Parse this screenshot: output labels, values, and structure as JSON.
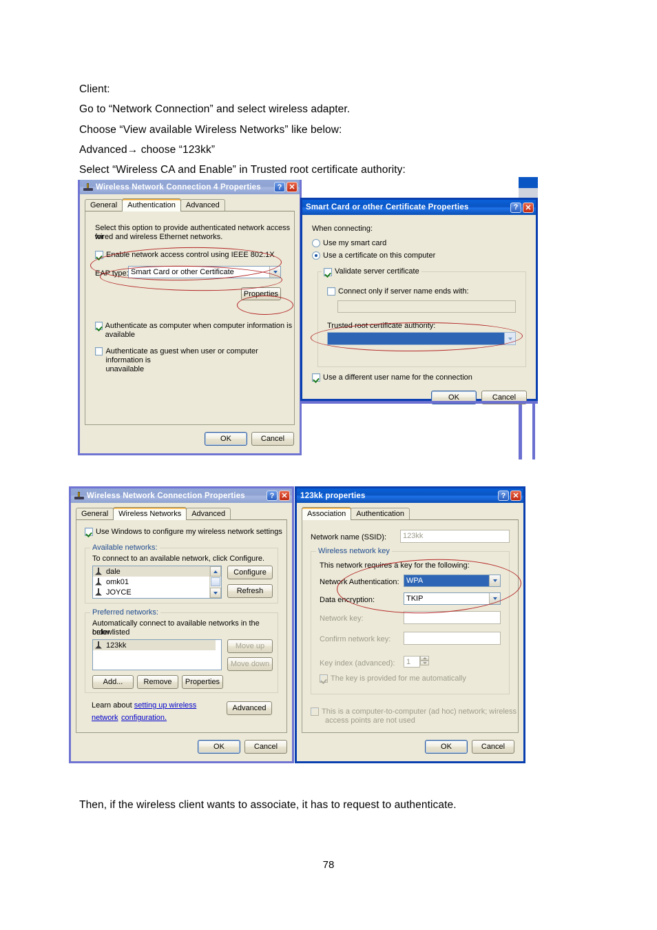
{
  "doc": {
    "lines": [
      "Client:",
      "Go to “Network Connection” and select wireless adapter.",
      "Choose “View available Wireless Networks” like below:",
      "Advanced→ choose “123kk”",
      "Select “Wireless CA and Enable” in Trusted root certificate authority:"
    ],
    "closing_line": "Then, if the wireless client wants to associate, it has to request to authenticate.",
    "page_number": "78"
  },
  "colors": {
    "title_active": "#0a55c4",
    "title_inactive": "#93a9d8",
    "dialog_face": "#ece9d8",
    "annotation_red": "#b22222",
    "selection_blue": "#2e66b5",
    "link_blue": "#0000cc"
  },
  "win_auth": {
    "title": "Wireless Network Connection 4 Properties",
    "help_btn": "?",
    "close_btn": "✕",
    "tabs": [
      {
        "label": "General",
        "selected": false
      },
      {
        "label": "Authentication",
        "selected": true
      },
      {
        "label": "Advanced",
        "selected": false
      }
    ],
    "intro_line1": "Select this option to provide authenticated network access for",
    "intro_line2": "wired and wireless Ethernet networks.",
    "enable_8021x": {
      "label": "Enable network access control using IEEE 802.1X",
      "checked": true
    },
    "eap_type_label": "EAP type:",
    "eap_type_value": "Smart Card or other Certificate",
    "properties_btn": "Properties",
    "auth_computer": {
      "label": "Authenticate as computer when computer information is available",
      "checked": true
    },
    "auth_guest_line1": "Authenticate as guest when user or computer information is",
    "auth_guest_line2": "unavailable",
    "auth_guest_checked": false,
    "ok_btn": "OK",
    "cancel_btn": "Cancel"
  },
  "win_smartcard": {
    "title": "Smart Card or other Certificate Properties",
    "help_btn": "?",
    "close_btn": "✕",
    "when_connecting": "When connecting:",
    "radio_smartcard": {
      "label": "Use my smart card",
      "selected": false
    },
    "radio_certificate": {
      "label": "Use a certificate on this computer",
      "selected": true
    },
    "validate_server": {
      "label": "Validate server certificate",
      "checked": true
    },
    "connect_only_if": {
      "label": "Connect only if server name ends with:",
      "checked": false
    },
    "server_name_value": "",
    "trusted_root_label": "Trusted root certificate authority:",
    "trusted_root_value": "",
    "different_user": {
      "label": "Use a different user name for the connection",
      "checked": true
    },
    "ok_btn": "OK",
    "cancel_btn": "Cancel"
  },
  "win_wnc": {
    "title": "Wireless Network Connection Properties",
    "help_btn": "?",
    "close_btn": "✕",
    "tabs": [
      {
        "label": "General",
        "selected": false
      },
      {
        "label": "Wireless Networks",
        "selected": true
      },
      {
        "label": "Advanced",
        "selected": false
      }
    ],
    "use_windows": {
      "label": "Use Windows to configure my wireless network settings",
      "checked": true
    },
    "available_group": "Available networks:",
    "available_hint": "To connect to an available network, click Configure.",
    "available_list": [
      "dale",
      "omk01",
      "JOYCE"
    ],
    "configure_btn": "Configure",
    "refresh_btn": "Refresh",
    "preferred_group": "Preferred networks:",
    "preferred_hint_line1": "Automatically connect to available networks in the order listed",
    "preferred_hint_line2": "below:",
    "preferred_list": [
      "123kk"
    ],
    "move_up_btn": "Move up",
    "move_down_btn": "Move down",
    "add_btn": "Add...",
    "remove_btn": "Remove",
    "properties_btn": "Properties",
    "learn_prefix": "Learn about ",
    "learn_link_line1": "setting up wireless network",
    "learn_link_line2": "configuration.",
    "advanced_btn": "Advanced",
    "ok_btn": "OK",
    "cancel_btn": "Cancel"
  },
  "win_123kk": {
    "title": "123kk properties",
    "help_btn": "?",
    "close_btn": "✕",
    "tabs": [
      {
        "label": "Association",
        "selected": true
      },
      {
        "label": "Authentication",
        "selected": false
      }
    ],
    "ssid_label": "Network name (SSID):",
    "ssid_value": "123kk",
    "key_group": "Wireless network key",
    "requires_key": "This network requires a key for the following:",
    "net_auth_label": "Network Authentication:",
    "net_auth_value": "WPA",
    "data_enc_label": "Data encryption:",
    "data_enc_value": "TKIP",
    "network_key_label": "Network key:",
    "network_key_value": "",
    "confirm_key_label": "Confirm network key:",
    "confirm_key_value": "",
    "key_index_label": "Key index (advanced):",
    "key_index_value": "1",
    "key_auto": {
      "label": "The key is provided for me automatically",
      "checked": true
    },
    "adhoc_line1": "This is a computer-to-computer (ad hoc) network; wireless",
    "adhoc_line2": "access points are not used",
    "adhoc_checked": false,
    "ok_btn": "OK",
    "cancel_btn": "Cancel"
  }
}
